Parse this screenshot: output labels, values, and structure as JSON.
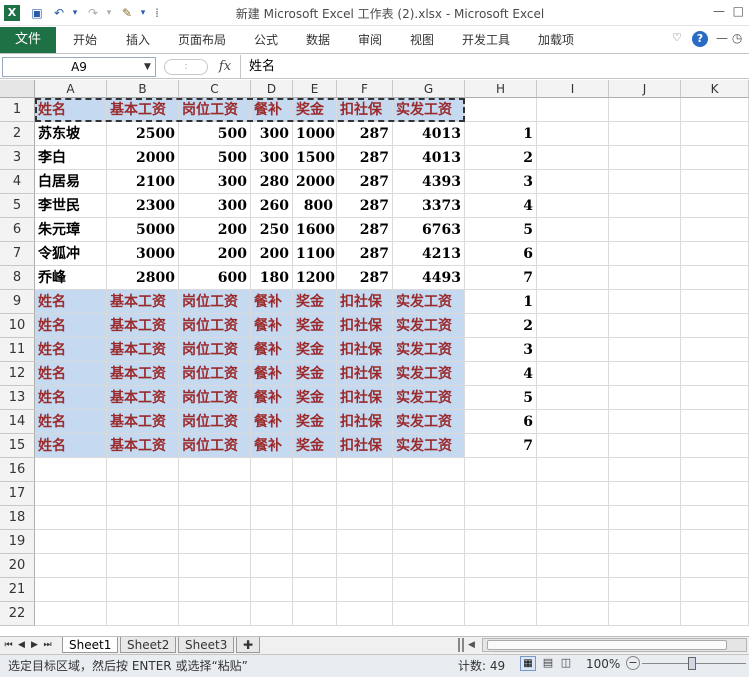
{
  "window": {
    "title": "新建 Microsoft Excel 工作表 (2).xlsx  -  Microsoft Excel"
  },
  "ribbon": {
    "file_tab": "文件",
    "tabs": [
      "开始",
      "插入",
      "页面布局",
      "公式",
      "数据",
      "审阅",
      "视图",
      "开发工具",
      "加载项"
    ]
  },
  "formula_bar": {
    "name_box": "A9",
    "fx_label": "fx",
    "content": "姓名"
  },
  "columns": [
    "A",
    "B",
    "C",
    "D",
    "E",
    "F",
    "G",
    "H",
    "I",
    "J",
    "K"
  ],
  "rows": [
    "1",
    "2",
    "3",
    "4",
    "5",
    "6",
    "7",
    "8",
    "9",
    "10",
    "11",
    "12",
    "13",
    "14",
    "15",
    "16",
    "17",
    "18",
    "19",
    "20",
    "21",
    "22"
  ],
  "sheet": {
    "header": [
      "姓名",
      "基本工资",
      "岗位工资",
      "餐补",
      "奖金",
      "扣社保",
      "实发工资"
    ],
    "data": [
      {
        "name": "苏东坡",
        "vals": [
          "2500",
          "500",
          "300",
          "1000",
          "287",
          "4013"
        ],
        "h": "1"
      },
      {
        "name": "李白",
        "vals": [
          "2000",
          "500",
          "300",
          "1500",
          "287",
          "4013"
        ],
        "h": "2"
      },
      {
        "name": "白居易",
        "vals": [
          "2100",
          "300",
          "280",
          "2000",
          "287",
          "4393"
        ],
        "h": "3"
      },
      {
        "name": "李世民",
        "vals": [
          "2300",
          "300",
          "260",
          "800",
          "287",
          "3373"
        ],
        "h": "4"
      },
      {
        "name": "朱元璋",
        "vals": [
          "5000",
          "200",
          "250",
          "1600",
          "287",
          "6763"
        ],
        "h": "5"
      },
      {
        "name": "令狐冲",
        "vals": [
          "3000",
          "200",
          "200",
          "1100",
          "287",
          "4213"
        ],
        "h": "6"
      },
      {
        "name": "乔峰",
        "vals": [
          "2800",
          "600",
          "180",
          "1200",
          "287",
          "4493"
        ],
        "h": "7"
      }
    ],
    "pasted_h": [
      "1",
      "2",
      "3",
      "4",
      "5",
      "6",
      "7"
    ]
  },
  "sheet_tabs": [
    "Sheet1",
    "Sheet2",
    "Sheet3"
  ],
  "status": {
    "message": "选定目标区域，然后按 ENTER 或选择“粘贴”",
    "count": "计数: 49",
    "zoom": "100%"
  },
  "colors": {
    "file_tab": "#1e7145",
    "selection": "#c5d9f1",
    "header_text": "#9b2b2b"
  }
}
